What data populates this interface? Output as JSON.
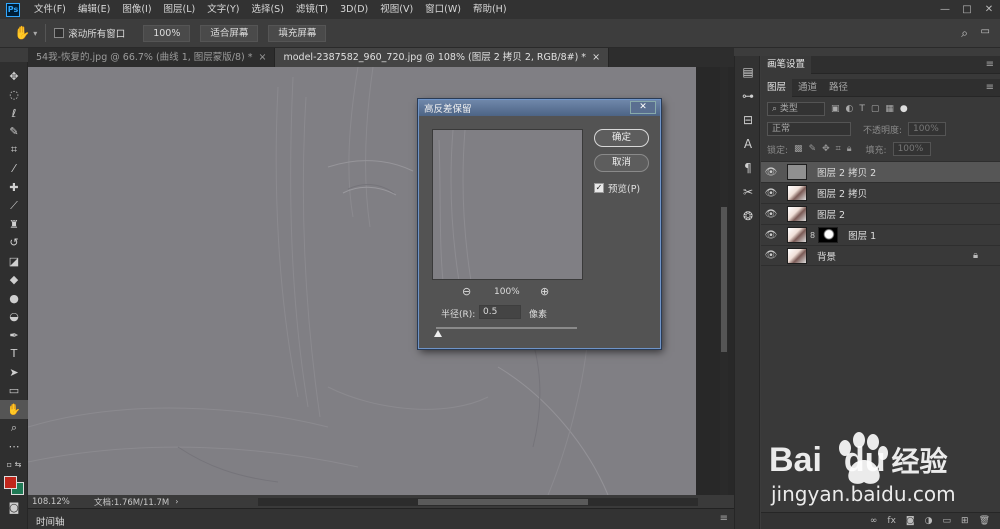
{
  "menubar": {
    "logo": "Ps",
    "items": [
      "文件(F)",
      "编辑(E)",
      "图像(I)",
      "图层(L)",
      "文字(Y)",
      "选择(S)",
      "滤镜(T)",
      "3D(D)",
      "视图(V)",
      "窗口(W)",
      "帮助(H)"
    ],
    "window_buttons": [
      "—",
      "□",
      "✕"
    ]
  },
  "options": {
    "scroll_all_label": "滚动所有窗口",
    "zoom_100": "100%",
    "fit_screen": "适合屏幕",
    "fill_screen": "填充屏幕"
  },
  "tabs": [
    {
      "label": "54我-恢复的.jpg @ 66.7% (曲线 1, 图层蒙版/8) *",
      "close": "×"
    },
    {
      "label": "model-2387582_960_720.jpg @ 108% (图层 2 拷贝 2, RGB/8#) *",
      "close": "×"
    }
  ],
  "status": {
    "zoom": "108.12%",
    "doc": "文档:1.76M/11.7M"
  },
  "timeline": {
    "label": "时间轴"
  },
  "dialog": {
    "title": "高反差保留",
    "close": "✕",
    "ok": "确定",
    "cancel": "取消",
    "preview_label": "预览(P)",
    "preview_check": "✓",
    "zoom_value": "100%",
    "radius_label": "半径(R):",
    "radius_value": "0.5",
    "radius_unit": "像素"
  },
  "panels": {
    "brush_tab": "画笔设置",
    "layers_tabs": [
      "图层",
      "通道",
      "路径"
    ],
    "kind_placeholder": "类型",
    "blend_mode": "正常",
    "opacity_label": "不透明度:",
    "opacity_value": "100%",
    "lock_label": "锁定:",
    "fill_label": "填充:",
    "fill_value": "100%"
  },
  "layers": [
    {
      "name": "图层 2 拷贝 2",
      "selected": true,
      "thumb": "gray"
    },
    {
      "name": "图层 2 拷贝",
      "selected": false,
      "thumb": "face"
    },
    {
      "name": "图层 2",
      "selected": false,
      "thumb": "face"
    },
    {
      "name": "图层 1",
      "selected": false,
      "thumb": "face",
      "mask": true
    },
    {
      "name": "背景",
      "selected": false,
      "thumb": "face",
      "locked": true
    }
  ],
  "watermark": {
    "brand_text": "Bai",
    "brand_text2": "du",
    "cn": "经验",
    "url": "jingyan.baidu.com"
  }
}
